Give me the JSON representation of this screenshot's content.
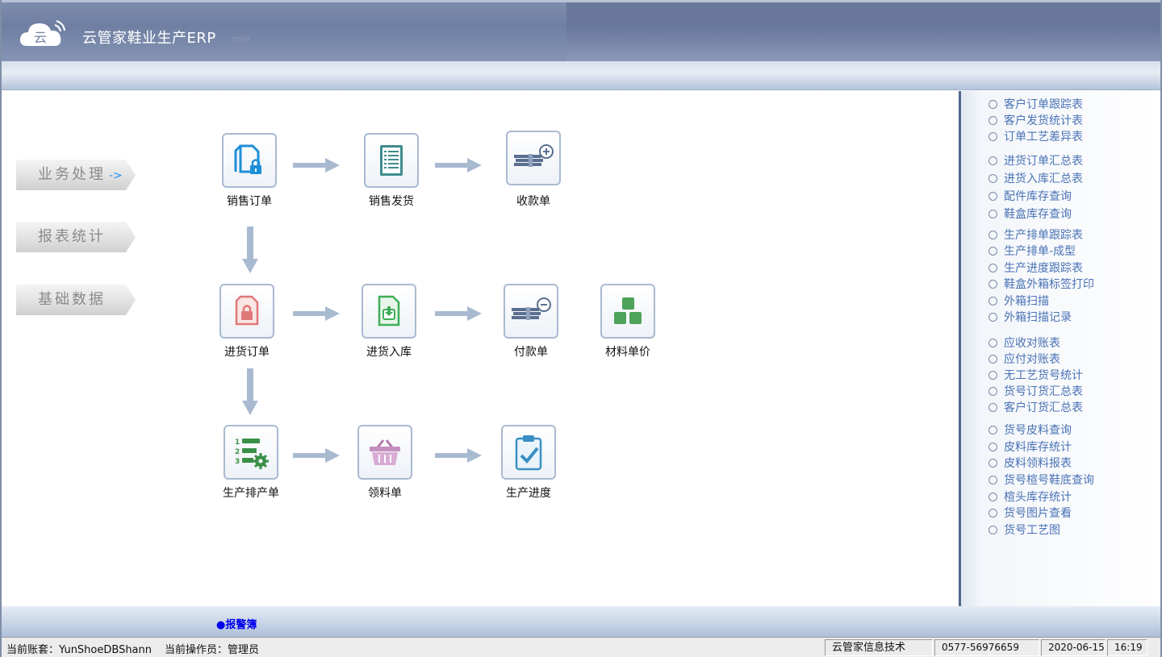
{
  "app": {
    "title": "云管家鞋业生产ERP",
    "title_suffix": "TOP"
  },
  "nav": [
    {
      "label": "业务处理",
      "arrow": "->"
    },
    {
      "label": "报表统计"
    },
    {
      "label": "基础数据"
    }
  ],
  "flow": {
    "sales_order": "销售订单",
    "sales_delivery": "销售发货",
    "receipt": "收款单",
    "purchase_order": "进货订单",
    "purchase_inbound": "进货入库",
    "payment": "付款单",
    "material_price": "材料单价",
    "production_schedule": "生产排产单",
    "material_requisition": "领料单",
    "production_progress": "生产进度"
  },
  "reports": [
    "客户订单跟踪表",
    "客户发货统计表",
    "订单工艺差异表",
    "进货订单汇总表",
    "进货入库汇总表",
    "配件库存查询",
    "鞋盒库存查询",
    "生产排单跟踪表",
    "生产排单-成型",
    "生产进度跟踪表",
    "鞋盒外箱标签打印",
    "外箱扫描",
    "外箱扫描记录",
    "应收对账表",
    "应付对账表",
    "无工艺货号统计",
    "货号订货汇总表",
    "客户订货汇总表",
    "货号皮料查询",
    "皮料库存统计",
    "皮料领料报表",
    "货号楦号鞋底查询",
    "楦头库存统计",
    "货号图片查看",
    "货号工艺图"
  ],
  "alarm": "●报警簿",
  "status": {
    "account": "当前账套：YunShoeDBShann",
    "operator": "当前操作员：管理员",
    "company": "云管家信息技术",
    "phone": "0577-56976659",
    "date": "2020-06-15",
    "time": "16:19"
  },
  "colors": {
    "header": "#7e8cad",
    "link": "#4a72b5",
    "arrow": "#a9bad0"
  }
}
